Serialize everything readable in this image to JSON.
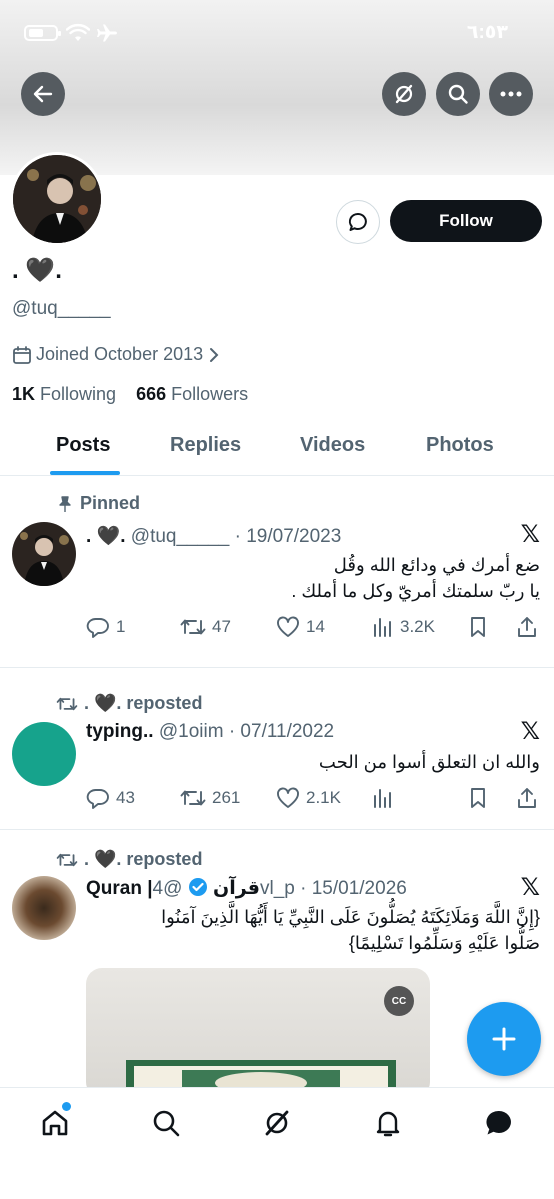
{
  "status_bar": {
    "time": "٦:٥٣"
  },
  "profile": {
    "name": ". 🖤.",
    "handle": "@tuq_____",
    "joined": "Joined October 2013",
    "following_count": "1K",
    "following_label": "Following",
    "followers_count": "666",
    "followers_label": "Followers",
    "follow_label": "Follow"
  },
  "tabs": [
    "Posts",
    "Replies",
    "Videos",
    "Photos"
  ],
  "posts": [
    {
      "context": "Pinned",
      "name": ". 🖤.",
      "handle": "@tuq_____",
      "date": "· 19/07/2023",
      "text_line1": "ضع أمرك في ودائع الله وقُل",
      "text_line2": "يا ربّ سلمتك أمريّ وكل ما أملك .",
      "replies": "1",
      "reposts": "47",
      "likes": "14",
      "views": "3.2K"
    },
    {
      "context": ". 🖤. reposted",
      "name": "typing..",
      "handle": "@1oiim",
      "date": "· 07/11/2022",
      "text_line1": "والله ان التعلق أسوا من الحب",
      "replies": "43",
      "reposts": "261",
      "likes": "2.1K"
    },
    {
      "context": ". 🖤. reposted",
      "name": "Quran |قرآن",
      "handle": "@4vl_p",
      "date": "· 15/01/2026",
      "text_line1": "{إِنَّ اللَّهَ وَمَلَائِكَتَهُ يُصَلُّونَ عَلَى النَّبِيِّ يَا أَيُّهَا الَّذِينَ آمَنُوا",
      "text_line2": "صَلُّوا عَلَيْهِ وَسَلِّمُوا تَسْلِيمًا}"
    }
  ],
  "media": {
    "cc_label": "CC"
  },
  "colors": {
    "accent": "#1d9bf0",
    "text": "#0f1419",
    "muted": "#536471"
  }
}
